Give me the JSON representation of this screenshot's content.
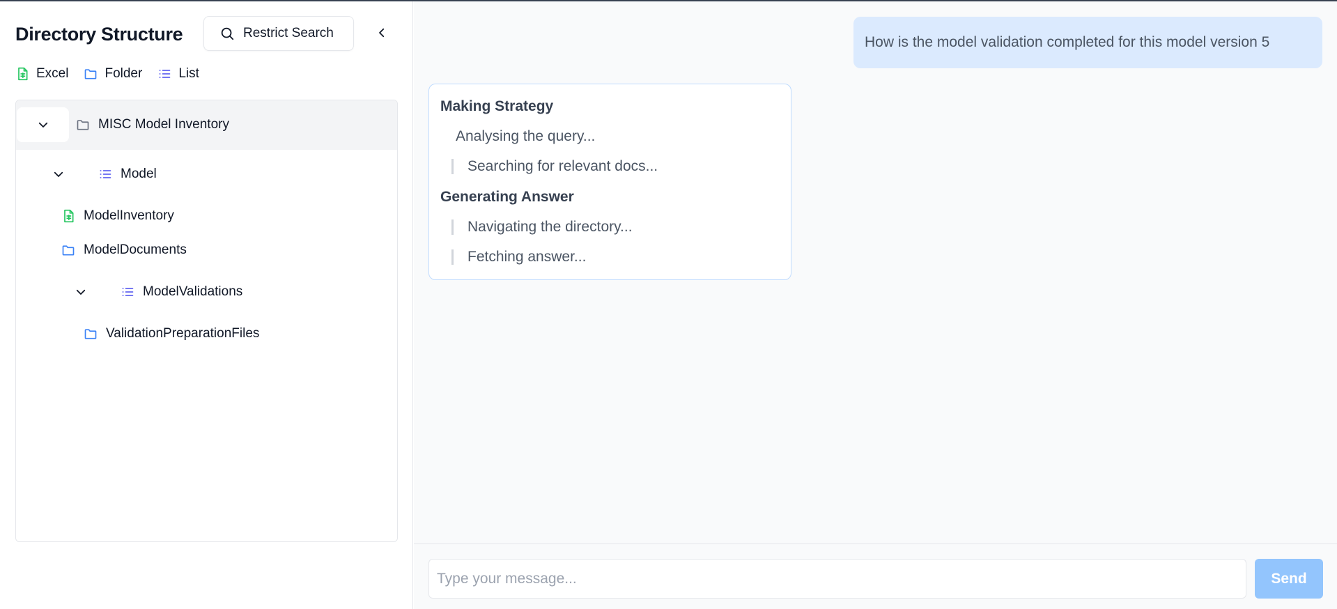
{
  "sidebar": {
    "title": "Directory Structure",
    "restrict_search_label": "Restrict Search",
    "legend": [
      {
        "label": "Excel",
        "icon": "file-spreadsheet-icon",
        "color": "#22c55e"
      },
      {
        "label": "Folder",
        "icon": "folder-icon",
        "color": "#3b82f6"
      },
      {
        "label": "List",
        "icon": "list-icon",
        "color": "#6366f1"
      }
    ],
    "tree": {
      "root": {
        "label": "MISC Model Inventory",
        "icon": "folder-icon",
        "expanded": true
      },
      "items": [
        {
          "label": "Model",
          "icon": "list-icon",
          "expanded": true
        },
        {
          "label": "ModelInventory",
          "icon": "file-spreadsheet-icon"
        },
        {
          "label": "ModelDocuments",
          "icon": "folder-icon"
        },
        {
          "label": "ModelValidations",
          "icon": "list-icon",
          "expanded": true
        },
        {
          "label": "ValidationPreparationFiles",
          "icon": "folder-icon"
        }
      ]
    }
  },
  "chat": {
    "user_message": "How is the model validation completed for this model version 5",
    "status": {
      "heading1": "Making Strategy",
      "step1": "Analysing the query...",
      "step2": "Searching for relevant docs...",
      "heading2": "Generating Answer",
      "step3": "Navigating the directory...",
      "step4": "Fetching answer..."
    },
    "composer": {
      "placeholder": "Type your message...",
      "send_label": "Send"
    }
  },
  "colors": {
    "accent": "#3b82f6",
    "user_bubble": "#dbeafe",
    "send_button": "#93c5fd",
    "excel": "#22c55e",
    "list": "#6366f1"
  }
}
